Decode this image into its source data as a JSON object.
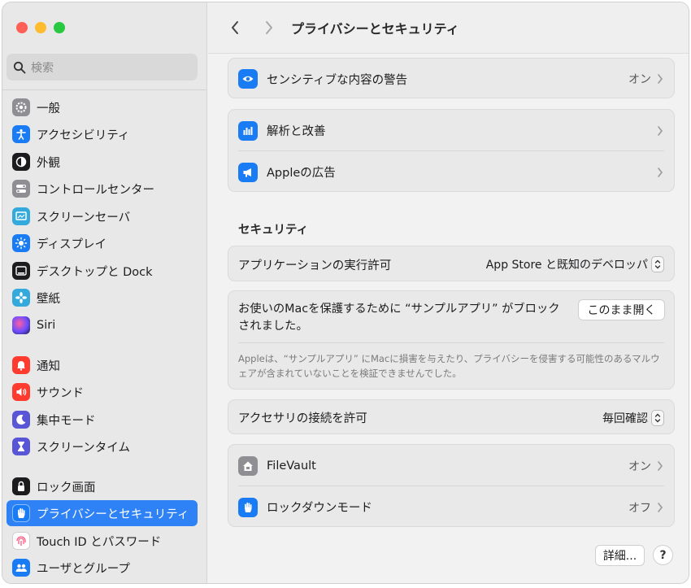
{
  "window": {
    "title": "プライバシーとセキュリティ"
  },
  "sidebar": {
    "search_placeholder": "検索",
    "items": [
      {
        "label": "一般",
        "icon": "gear-icon",
        "color": "#8e8e93"
      },
      {
        "label": "アクセシビリティ",
        "icon": "accessibility-icon",
        "color": "#1a7cf5"
      },
      {
        "label": "外観",
        "icon": "appearance-icon",
        "color": "#1c1c1e"
      },
      {
        "label": "コントロールセンター",
        "icon": "control-center-icon",
        "color": "#8e8e93"
      },
      {
        "label": "スクリーンセーバ",
        "icon": "screensaver-icon",
        "color": "#34aadc"
      },
      {
        "label": "ディスプレイ",
        "icon": "display-icon",
        "color": "#1a7cf5"
      },
      {
        "label": "デスクトップと Dock",
        "icon": "dock-icon",
        "color": "#1c1c1e"
      },
      {
        "label": "壁紙",
        "icon": "wallpaper-icon",
        "color": "#34aadc"
      },
      {
        "label": "Siri",
        "icon": "siri-icon",
        "color": "#3a3a8c"
      },
      {
        "label": "通知",
        "icon": "notification-icon",
        "color": "#ff3b30"
      },
      {
        "label": "サウンド",
        "icon": "sound-icon",
        "color": "#ff3b30"
      },
      {
        "label": "集中モード",
        "icon": "moon-icon",
        "color": "#5856d6"
      },
      {
        "label": "スクリーンタイム",
        "icon": "hourglass-icon",
        "color": "#5856d6"
      },
      {
        "label": "ロック画面",
        "icon": "lock-icon",
        "color": "#1c1c1e"
      },
      {
        "label": "プライバシーとセキュリティ",
        "icon": "hand-icon",
        "color": "#1a7cf5",
        "active": true
      },
      {
        "label": "Touch ID とパスワード",
        "icon": "fingerprint-icon",
        "color": "#ffffff"
      },
      {
        "label": "ユーザとグループ",
        "icon": "users-icon",
        "color": "#1a7cf5"
      }
    ]
  },
  "privacy": {
    "sensitive_warning": {
      "label": "センシティブな内容の警告",
      "value": "オン"
    },
    "analytics": {
      "label": "解析と改善"
    },
    "apple_ads": {
      "label": "Appleの広告"
    }
  },
  "security": {
    "heading": "セキュリティ",
    "app_permission": {
      "label": "アプリケーションの実行許可",
      "value": "App Store と既知のデベロッパ"
    },
    "blocked": {
      "message": "お使いのMacを保護するために “サンプルアプリ” がブロックされました。",
      "open_anyway": "このまま開く",
      "detail": "Appleは、“サンプルアプリ” にMacに損害を与えたり、プライバシーを侵害する可能性のあるマルウェアが含まれていないことを検証できませんでした。"
    },
    "accessory": {
      "label": "アクセサリの接続を許可",
      "value": "毎回確認"
    },
    "filevault": {
      "label": "FileVault",
      "value": "オン"
    },
    "lockdown": {
      "label": "ロックダウンモード",
      "value": "オフ"
    }
  },
  "footer": {
    "details_button": "詳細...",
    "help_button": "?"
  },
  "colors": {
    "accent": "#2f82f6"
  }
}
